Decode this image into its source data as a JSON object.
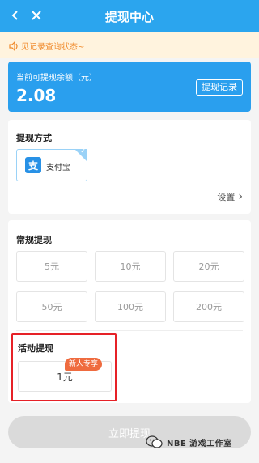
{
  "header": {
    "title": "提现中心"
  },
  "notice": {
    "text": "见记录查询状态~"
  },
  "balance": {
    "label": "当前可提现余额（元）",
    "amount": "2.08",
    "records_button": "提现记录"
  },
  "method": {
    "title": "提现方式",
    "option_logo": "支",
    "option_name": "支付宝",
    "settings_label": "设置"
  },
  "regular": {
    "title": "常规提现",
    "amounts": [
      "5元",
      "10元",
      "20元",
      "50元",
      "100元",
      "200元"
    ]
  },
  "activity": {
    "title": "活动提现",
    "amount": "1元",
    "badge": "新人专享"
  },
  "submit": {
    "label": "立即提现"
  },
  "watermark": {
    "text": "NBE 游戏工作室"
  },
  "colors": {
    "primary": "#2ba5ee",
    "highlight": "#e62127",
    "badge": "#ef6b3f",
    "notice_text": "#f08a2b"
  }
}
